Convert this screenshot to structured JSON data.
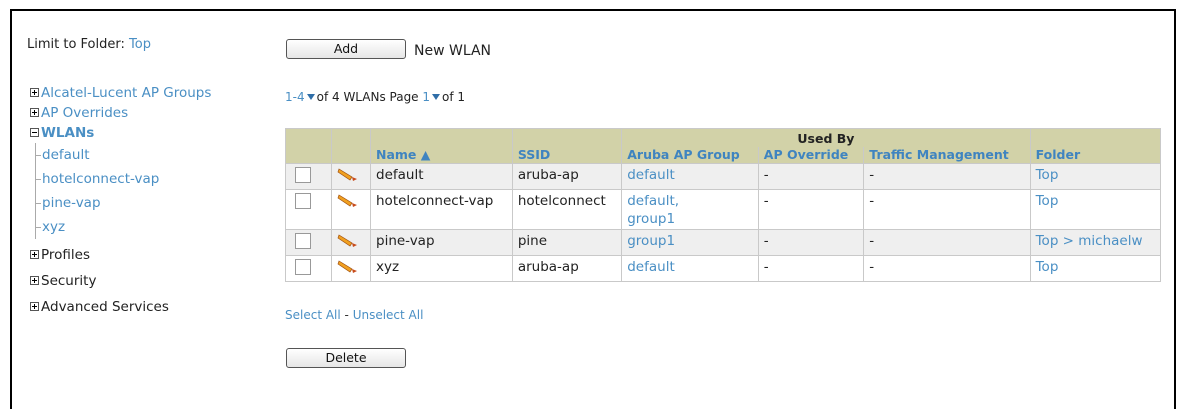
{
  "limit": {
    "label": "Limit to Folder:",
    "folder": "Top"
  },
  "tree": {
    "items": [
      {
        "label": "Alcatel-Lucent AP Groups"
      },
      {
        "label": "AP Overrides"
      },
      {
        "label": "WLANs"
      },
      {
        "label": "Profiles"
      },
      {
        "label": "Security"
      },
      {
        "label": "Advanced Services"
      }
    ],
    "wlan_children": [
      "default",
      "hotelconnect-vap",
      "pine-vap",
      "xyz"
    ]
  },
  "toolbar": {
    "add_label": "Add",
    "new_wlan_label": "New WLAN",
    "delete_label": "Delete"
  },
  "pager": {
    "range": "1-4",
    "of_text": "of 4 WLANs  Page",
    "page": "1",
    "of_pages": "of 1"
  },
  "table": {
    "group_header": "Used By",
    "columns": [
      "Name ▲",
      "SSID",
      "Aruba AP Group",
      "AP Override",
      "Traffic Management",
      "Folder"
    ],
    "rows": [
      {
        "name": "default",
        "ssid": "aruba-ap",
        "group": "default",
        "group2": "",
        "override": "-",
        "traffic": "-",
        "folder": "Top"
      },
      {
        "name": "hotelconnect-vap",
        "ssid": "hotelconnect",
        "group": "default,",
        "group2": "group1",
        "override": "-",
        "traffic": "-",
        "folder": "Top"
      },
      {
        "name": "pine-vap",
        "ssid": "pine",
        "group": "group1",
        "group2": "",
        "override": "-",
        "traffic": "-",
        "folder": "Top > michaelw"
      },
      {
        "name": "xyz",
        "ssid": "aruba-ap",
        "group": "default",
        "group2": "",
        "override": "-",
        "traffic": "-",
        "folder": "Top"
      }
    ]
  },
  "selection": {
    "select_all": "Select All",
    "separator": " - ",
    "unselect_all": "Unselect All"
  },
  "icons": {
    "row_edit": "pencil-icon"
  }
}
